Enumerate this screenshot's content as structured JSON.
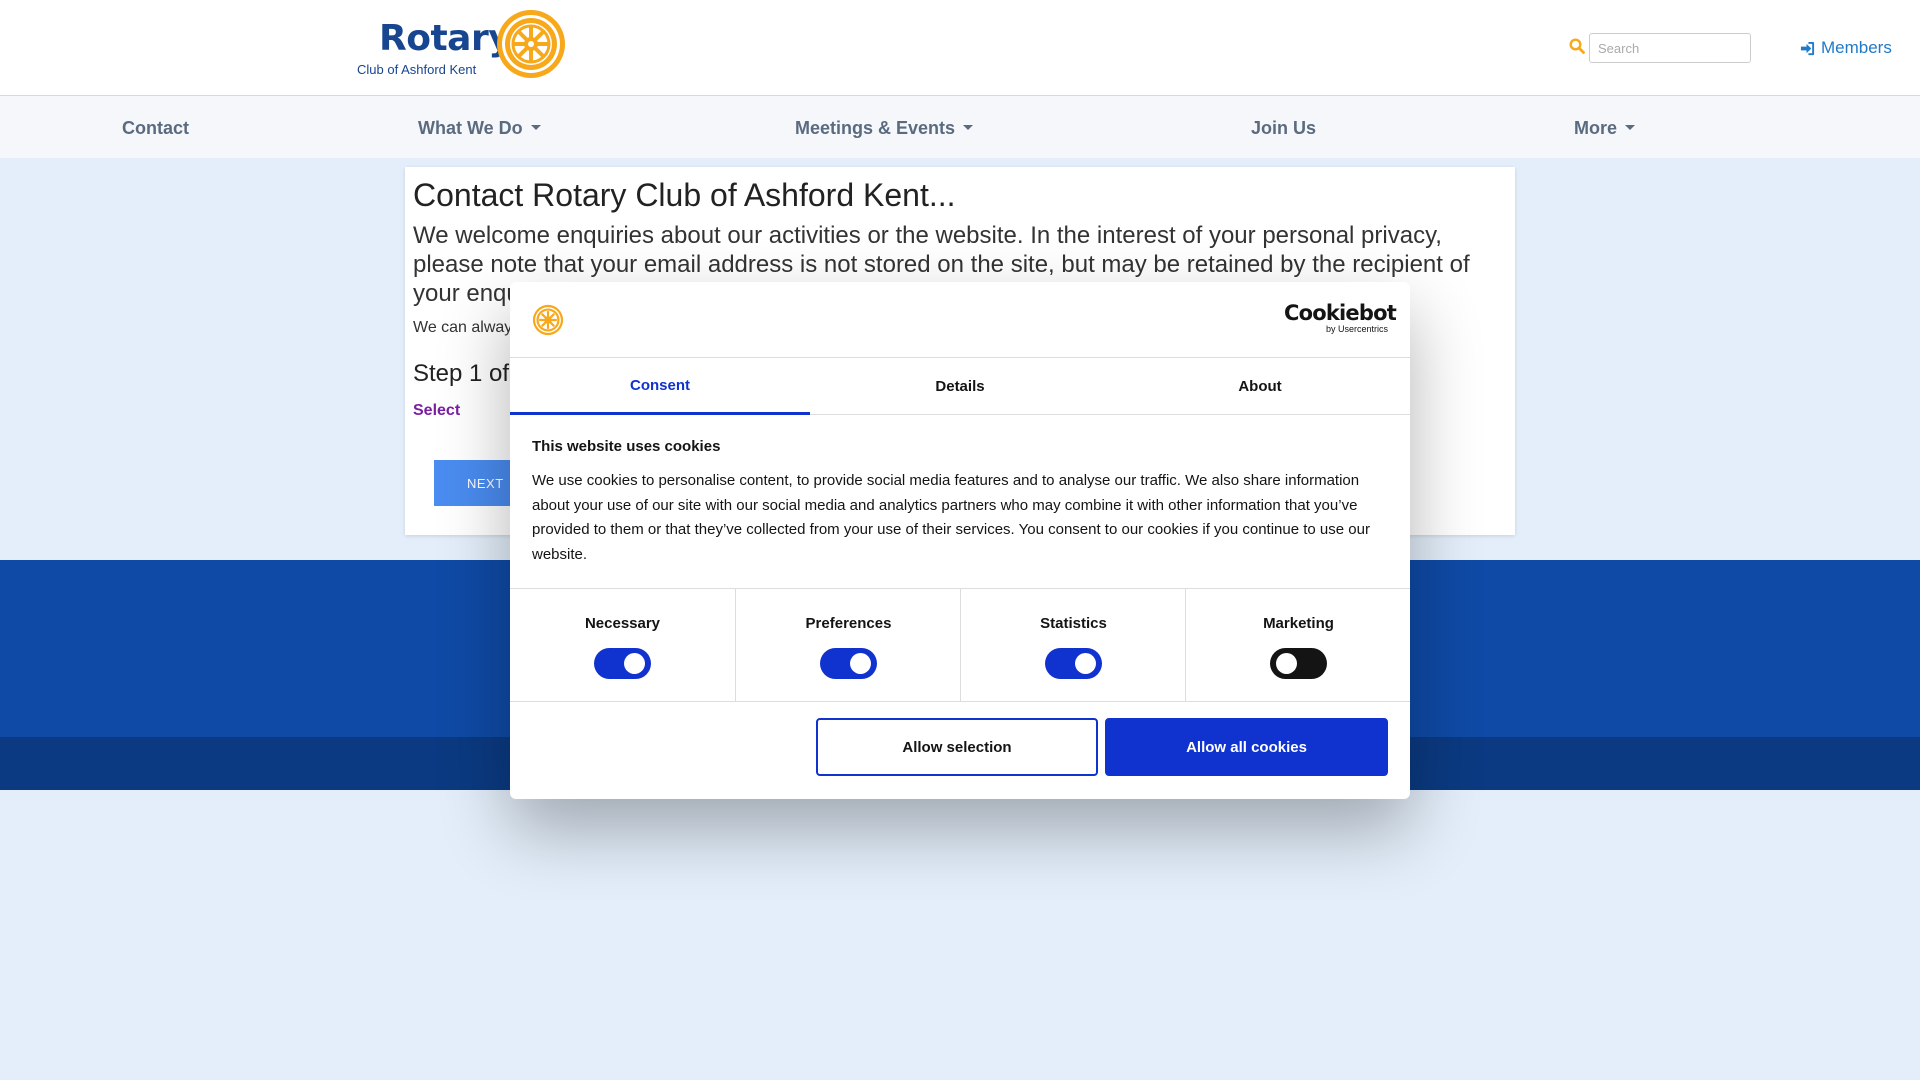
{
  "header": {
    "logo_word": "Rotary",
    "logo_subtitle": "Club of Ashford Kent",
    "search_placeholder": "Search",
    "members_label": "Members"
  },
  "nav": {
    "items": [
      {
        "label": "Contact",
        "dropdown": false
      },
      {
        "label": "What We Do",
        "dropdown": true
      },
      {
        "label": "Meetings & Events",
        "dropdown": true
      },
      {
        "label": "Join Us",
        "dropdown": false
      },
      {
        "label": "More",
        "dropdown": true
      }
    ]
  },
  "main": {
    "title": "Contact Rotary Club of Ashford Kent...",
    "intro": "We welcome enquiries about our activities or the website. In the interest of your personal privacy, please note that your email address is not stored on the site, but may be retained by the recipient of your enquiry.",
    "note": "We can alway",
    "step": "Step 1 of",
    "select_label": "Select",
    "next_button": "NEXT"
  },
  "cookie_dialog": {
    "brand": "Cookiebot",
    "brand_sub": "by Usercentrics",
    "tabs": [
      "Consent",
      "Details",
      "About"
    ],
    "active_tab": "Consent",
    "heading": "This website uses cookies",
    "body": "We use cookies to personalise content, to provide social media features and to analyse our traffic. We also share information about your use of our site with our social media and analytics partners who may combine it with other information that you’ve provided to them or that they’ve collected from your use of their services. You consent to our cookies if you continue to use our website.",
    "toggles": [
      {
        "label": "Necessary",
        "on": true
      },
      {
        "label": "Preferences",
        "on": true
      },
      {
        "label": "Statistics",
        "on": true
      },
      {
        "label": "Marketing",
        "on": false
      }
    ],
    "allow_selection": "Allow selection",
    "allow_all": "Allow all cookies"
  },
  "colors": {
    "rotary_blue": "#17458f",
    "rotary_gold": "#f7a81b",
    "cookiebot_blue": "#1032cf",
    "footer_blue": "#0f4aa6",
    "footer_dark": "#0b3a82",
    "page_bg": "#e3eefa",
    "select_purple": "#7b1fa2"
  },
  "icons": {
    "search": "search-icon",
    "members": "sign-in-icon",
    "logo": "rotary-wheel-icon"
  }
}
